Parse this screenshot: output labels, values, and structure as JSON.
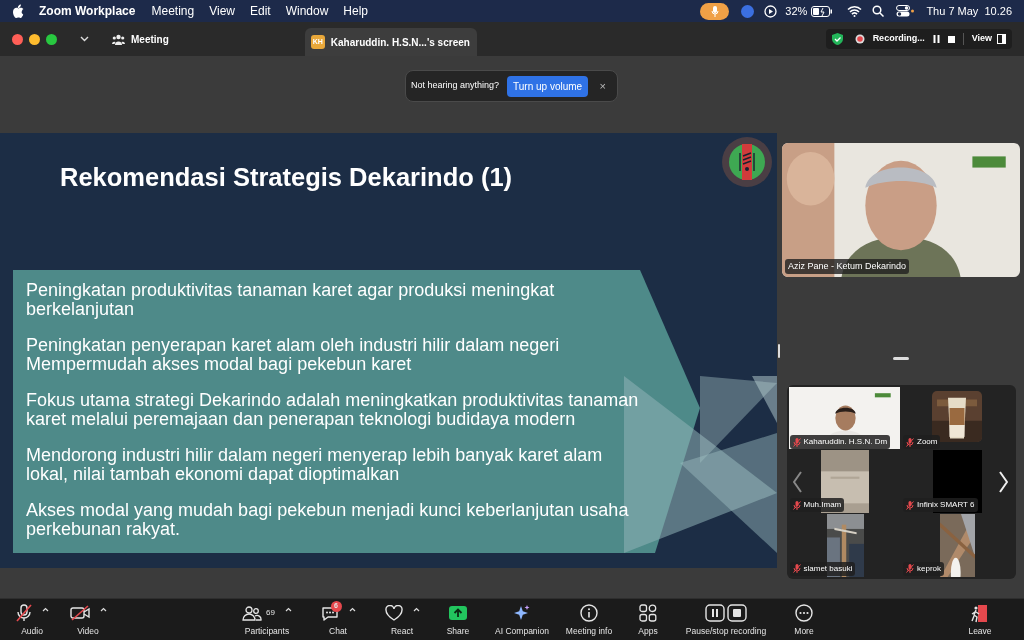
{
  "menubar": {
    "app": "Zoom Workplace",
    "menus": [
      "Meeting",
      "View",
      "Edit",
      "Window",
      "Help"
    ],
    "battery": "32%",
    "clock": "Thu 7 May  10.26"
  },
  "titlebar": {
    "meeting_label": "Meeting",
    "tab": {
      "initials": "KH",
      "title": "Kaharuddin. H.S.N...'s screen"
    },
    "recording": "Recording...",
    "view": "View"
  },
  "toast": {
    "message": "Not hearing anything?",
    "action": "Turn up volume",
    "close": "×"
  },
  "slide": {
    "title": "Rekomendasi Strategis Dekarindo (1)",
    "groups": [
      [
        {
          "lines": [
            "Peningkatan produktivitas tanaman karet agar produksi meningkat",
            "berkelanjutan"
          ]
        }
      ],
      [
        {
          "lines": [
            "Peningkatan penyerapan karet alam oleh industri hilir dalam negeri"
          ]
        },
        {
          "lines": [
            "Mempermudah akses modal bagi pekebun karet"
          ]
        }
      ],
      [
        {
          "lines": [
            "Fokus utama strategi Dekarindo adalah meningkatkan produktivitas tanaman",
            "karet melalui peremajaan dan penerapan teknologi budidaya modern"
          ]
        }
      ],
      [
        {
          "lines": [
            "Mendorong industri hilir dalam negeri menyerap lebih banyak karet alam",
            "lokal, nilai tambah ekonomi dapat dioptimalkan"
          ]
        }
      ],
      [
        {
          "lines": [
            "Akses modal yang mudah bagi pekebun menjadi kunci keberlanjutan usaha",
            "perkebunan rakyat."
          ]
        }
      ]
    ]
  },
  "speaker": {
    "name": "Aziz Pane - Ketum Dekarindo"
  },
  "gallery": [
    {
      "name": "Kaharuddin. H.S.N. Dm",
      "muted": true
    },
    {
      "name": "Zoom",
      "muted": true
    },
    {
      "name": "Muh.Imam",
      "muted": true
    },
    {
      "name": "Infinix SMART 6",
      "muted": true
    },
    {
      "name": "slamet basuki",
      "muted": true
    },
    {
      "name": "keprok",
      "muted": true
    }
  ],
  "toolbar": [
    {
      "kind": "audio",
      "label": "Audio",
      "off": true,
      "caret": true
    },
    {
      "kind": "video",
      "label": "Video",
      "off": true,
      "caret": true
    },
    {
      "kind": "participants",
      "label": "Participants",
      "count": "69",
      "caret": true
    },
    {
      "kind": "chat",
      "label": "Chat",
      "badge": "6",
      "caret": true
    },
    {
      "kind": "react",
      "label": "React",
      "caret": true
    },
    {
      "kind": "share",
      "label": "Share",
      "caret": false
    },
    {
      "kind": "ai",
      "label": "AI Companion",
      "caret": false
    },
    {
      "kind": "info",
      "label": "Meeting info",
      "caret": false
    },
    {
      "kind": "apps",
      "label": "Apps",
      "caret": false
    },
    {
      "kind": "record",
      "label": "Pause/stop recording",
      "caret": false
    },
    {
      "kind": "more",
      "label": "More",
      "caret": false
    },
    {
      "kind": "leave",
      "label": "Leave",
      "caret": false
    }
  ]
}
